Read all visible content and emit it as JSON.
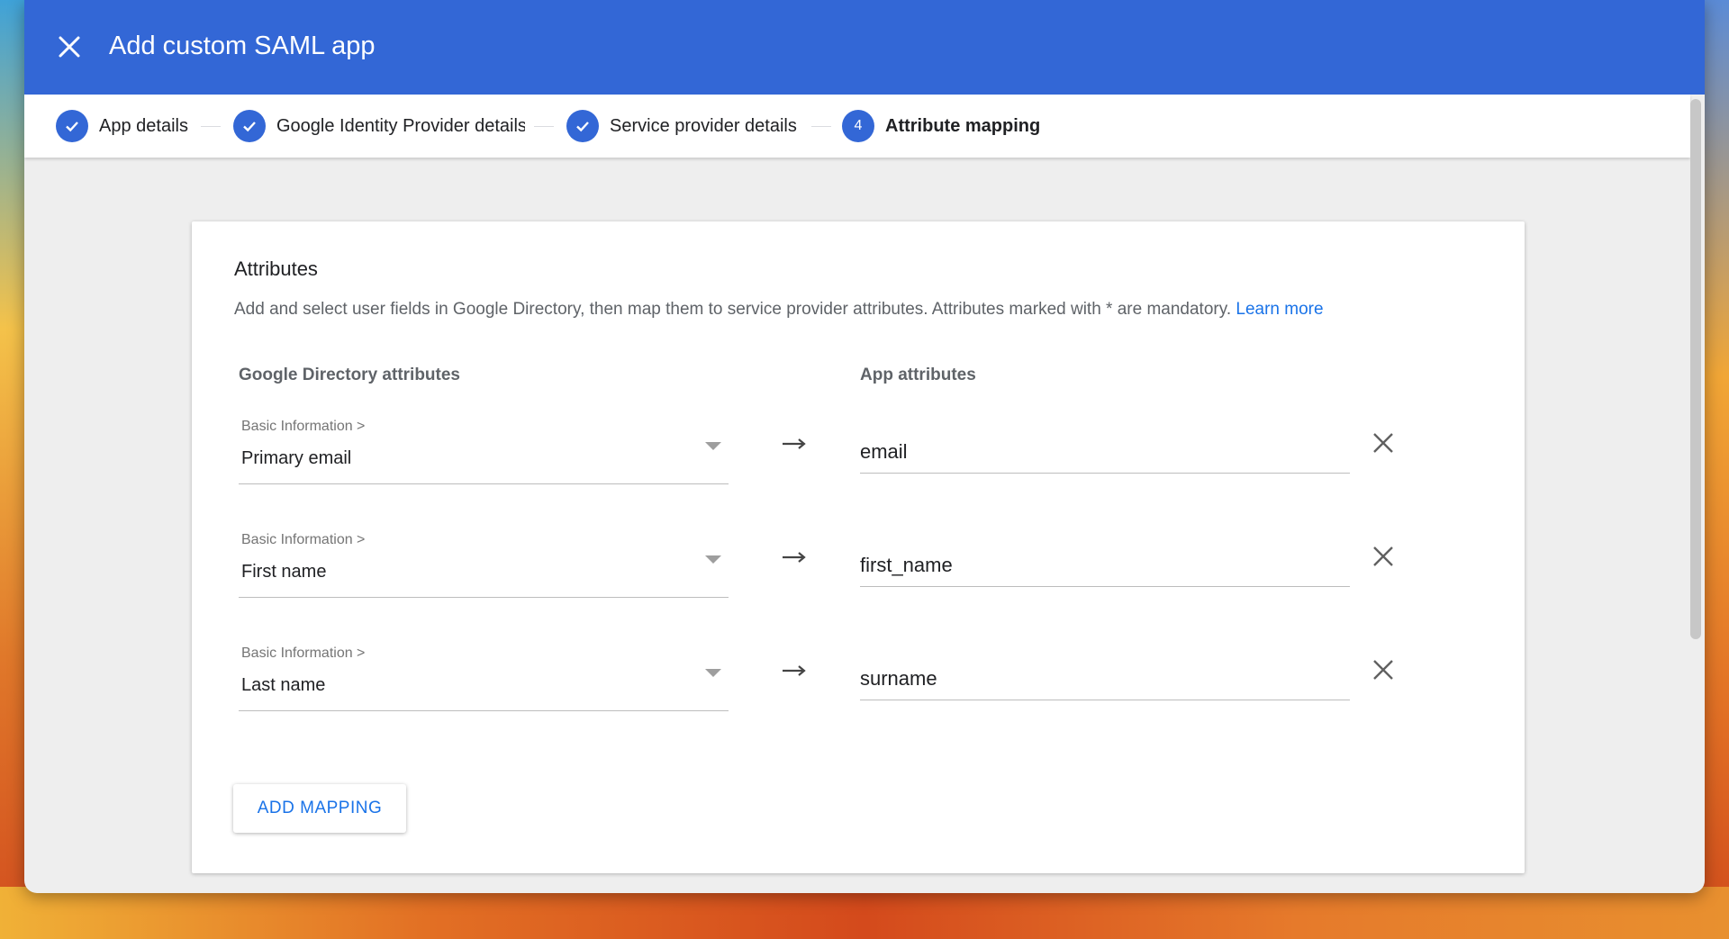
{
  "header": {
    "title": "Add custom SAML app"
  },
  "stepper": {
    "steps": [
      {
        "label": "App details",
        "state": "done"
      },
      {
        "label": "Google Identity Provider details",
        "state": "done"
      },
      {
        "label": "Service provider details",
        "state": "done"
      },
      {
        "label": "Attribute mapping",
        "state": "active",
        "number": "4"
      }
    ]
  },
  "card": {
    "title": "Attributes",
    "description": "Add and select user fields in Google Directory, then map them to service provider attributes. Attributes marked with * are mandatory.",
    "learn_more": "Learn more",
    "col_left": "Google Directory attributes",
    "col_right": "App attributes",
    "mappings": [
      {
        "category": "Basic Information >",
        "field": "Primary email",
        "app_attr": "email"
      },
      {
        "category": "Basic Information >",
        "field": "First name",
        "app_attr": "first_name"
      },
      {
        "category": "Basic Information >",
        "field": "Last name",
        "app_attr": "surname"
      }
    ],
    "add_button": "ADD MAPPING"
  },
  "colors": {
    "accent": "#3367d6",
    "link": "#1a73e8"
  }
}
